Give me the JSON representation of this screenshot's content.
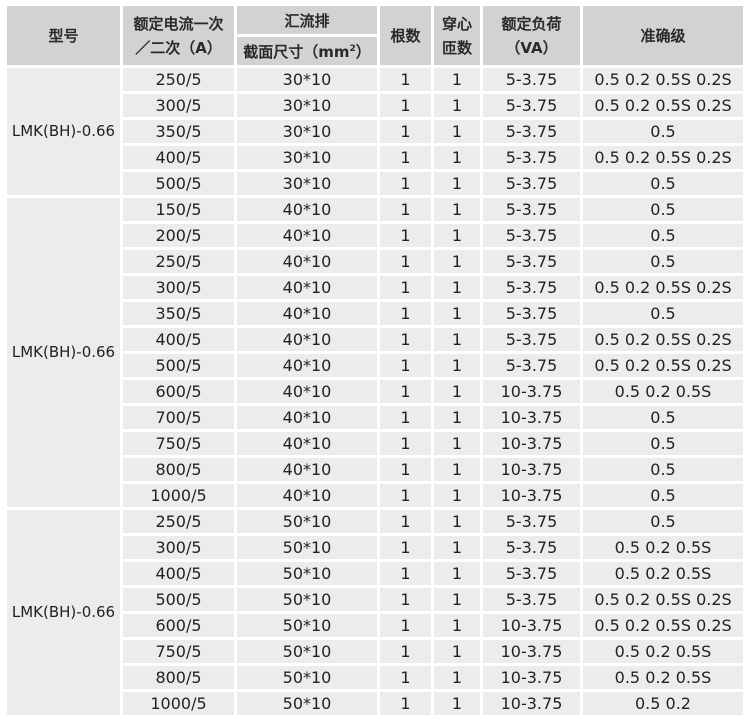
{
  "header": {
    "model": "型号",
    "rated_current_line1": "额定电流一次",
    "rated_current_line2": "／二次（A）",
    "busbar": "汇流排",
    "busbar_section": "截面尺寸（mm",
    "busbar_section_sup": "2",
    "busbar_section_end": "）",
    "count": "根数",
    "turns_line1": "穿心",
    "turns_line2": "匝数",
    "burden_line1": "额定负荷",
    "burden_line2": "（VA）",
    "accuracy": "准确级"
  },
  "groups": [
    {
      "model": "LMK(BH)-0.66",
      "rows": [
        {
          "current": "250/5",
          "section": "30*10",
          "count": "1",
          "turns": "1",
          "burden": "5-3.75",
          "accuracy": "0.5 0.2 0.5S 0.2S"
        },
        {
          "current": "300/5",
          "section": "30*10",
          "count": "1",
          "turns": "1",
          "burden": "5-3.75",
          "accuracy": "0.5 0.2 0.5S 0.2S"
        },
        {
          "current": "350/5",
          "section": "30*10",
          "count": "1",
          "turns": "1",
          "burden": "5-3.75",
          "accuracy": "0.5"
        },
        {
          "current": "400/5",
          "section": "30*10",
          "count": "1",
          "turns": "1",
          "burden": "5-3.75",
          "accuracy": "0.5 0.2 0.5S 0.2S"
        },
        {
          "current": "500/5",
          "section": "30*10",
          "count": "1",
          "turns": "1",
          "burden": "5-3.75",
          "accuracy": "0.5"
        }
      ]
    },
    {
      "model": "LMK(BH)-0.66",
      "rows": [
        {
          "current": "150/5",
          "section": "40*10",
          "count": "1",
          "turns": "1",
          "burden": "5-3.75",
          "accuracy": "0.5"
        },
        {
          "current": "200/5",
          "section": "40*10",
          "count": "1",
          "turns": "1",
          "burden": "5-3.75",
          "accuracy": "0.5"
        },
        {
          "current": "250/5",
          "section": "40*10",
          "count": "1",
          "turns": "1",
          "burden": "5-3.75",
          "accuracy": "0.5"
        },
        {
          "current": "300/5",
          "section": "40*10",
          "count": "1",
          "turns": "1",
          "burden": "5-3.75",
          "accuracy": "0.5 0.2 0.5S 0.2S"
        },
        {
          "current": "350/5",
          "section": "40*10",
          "count": "1",
          "turns": "1",
          "burden": "5-3.75",
          "accuracy": "0.5"
        },
        {
          "current": "400/5",
          "section": "40*10",
          "count": "1",
          "turns": "1",
          "burden": "5-3.75",
          "accuracy": "0.5 0.2 0.5S 0.2S"
        },
        {
          "current": "500/5",
          "section": "40*10",
          "count": "1",
          "turns": "1",
          "burden": "5-3.75",
          "accuracy": "0.5 0.2 0.5S 0.2S"
        },
        {
          "current": "600/5",
          "section": "40*10",
          "count": "1",
          "turns": "1",
          "burden": "10-3.75",
          "accuracy": "0.5  0.2 0.5S"
        },
        {
          "current": "700/5",
          "section": "40*10",
          "count": "1",
          "turns": "1",
          "burden": "10-3.75",
          "accuracy": "0.5"
        },
        {
          "current": "750/5",
          "section": "40*10",
          "count": "1",
          "turns": "1",
          "burden": "10-3.75",
          "accuracy": "0.5"
        },
        {
          "current": "800/5",
          "section": "40*10",
          "count": "1",
          "turns": "1",
          "burden": "10-3.75",
          "accuracy": "0.5"
        },
        {
          "current": "1000/5",
          "section": "40*10",
          "count": "1",
          "turns": "1",
          "burden": "10-3.75",
          "accuracy": "0.5"
        }
      ]
    },
    {
      "model": "LMK(BH)-0.66",
      "rows": [
        {
          "current": "250/5",
          "section": "50*10",
          "count": "1",
          "turns": "1",
          "burden": "5-3.75",
          "accuracy": "0.5"
        },
        {
          "current": "300/5",
          "section": "50*10",
          "count": "1",
          "turns": "1",
          "burden": "5-3.75",
          "accuracy": "0.5  0.2  0.5S"
        },
        {
          "current": "400/5",
          "section": "50*10",
          "count": "1",
          "turns": "1",
          "burden": "5-3.75",
          "accuracy": "0.5  0.2  0.5S"
        },
        {
          "current": "500/5",
          "section": "50*10",
          "count": "1",
          "turns": "1",
          "burden": "5-3.75",
          "accuracy": "0.5 0.2 0.5S 0.2S"
        },
        {
          "current": "600/5",
          "section": "50*10",
          "count": "1",
          "turns": "1",
          "burden": "10-3.75",
          "accuracy": "0.5 0.2 0.5S 0.2S"
        },
        {
          "current": "750/5",
          "section": "50*10",
          "count": "1",
          "turns": "1",
          "burden": "10-3.75",
          "accuracy": "0.5  0.2  0.5S"
        },
        {
          "current": "800/5",
          "section": "50*10",
          "count": "1",
          "turns": "1",
          "burden": "10-3.75",
          "accuracy": "0.5  0.2  0.5S"
        },
        {
          "current": "1000/5",
          "section": "50*10",
          "count": "1",
          "turns": "1",
          "burden": "10-3.75",
          "accuracy": "0.5   0.2"
        }
      ]
    }
  ]
}
